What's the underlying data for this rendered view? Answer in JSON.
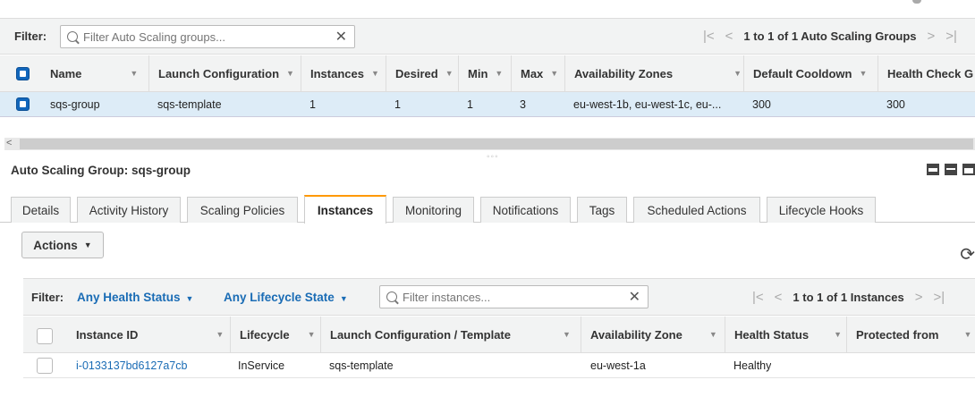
{
  "top_filter": {
    "label": "Filter:",
    "search_placeholder": "Filter Auto Scaling groups...",
    "clear_glyph": "✕",
    "pager": {
      "first": "|<",
      "prev": "<",
      "text": "1 to 1 of 1 Auto Scaling Groups",
      "next": ">",
      "last": ">|"
    }
  },
  "asg_table": {
    "columns": [
      "Name",
      "Launch Configuration",
      "Instances",
      "Desired",
      "Min",
      "Max",
      "Availability Zones",
      "Default Cooldown",
      "Health Check G"
    ],
    "rows": [
      {
        "name": "sqs-group",
        "launch_configuration": "sqs-template",
        "instances": "1",
        "desired": "1",
        "min": "1",
        "max": "3",
        "availability_zones": "eu-west-1b, eu-west-1c, eu-...",
        "default_cooldown": "300",
        "health_check": "300"
      }
    ]
  },
  "scrollbar": {
    "left_arrow": "<"
  },
  "drag_handle": "◦◦◦",
  "details": {
    "title": "Auto Scaling Group: sqs-group",
    "tabs": [
      "Details",
      "Activity History",
      "Scaling Policies",
      "Instances",
      "Monitoring",
      "Notifications",
      "Tags",
      "Scheduled Actions",
      "Lifecycle Hooks"
    ],
    "active_tab": "Instances",
    "actions_label": "Actions",
    "refresh_glyph": "⟳"
  },
  "instances_filter": {
    "label": "Filter:",
    "health_status": "Any Health Status",
    "lifecycle_state": "Any Lifecycle State",
    "search_placeholder": "Filter instances...",
    "clear_glyph": "✕",
    "pager": {
      "first": "|<",
      "prev": "<",
      "text": "1 to 1 of 1 Instances",
      "next": ">",
      "last": ">|"
    }
  },
  "instances_table": {
    "columns": [
      "Instance ID",
      "Lifecycle",
      "Launch Configuration / Template",
      "Availability Zone",
      "Health Status",
      "Protected from"
    ],
    "rows": [
      {
        "instance_id": "i-0133137bd6127a7cb",
        "lifecycle": "InService",
        "launch_config": "sqs-template",
        "az": "eu-west-1a",
        "health": "Healthy",
        "protected": ""
      }
    ]
  },
  "colors": {
    "link": "#1a6cb5",
    "active_tab_accent": "#ff9900",
    "selected_row": "#ddecf7",
    "checkbox": "#1166bb"
  }
}
